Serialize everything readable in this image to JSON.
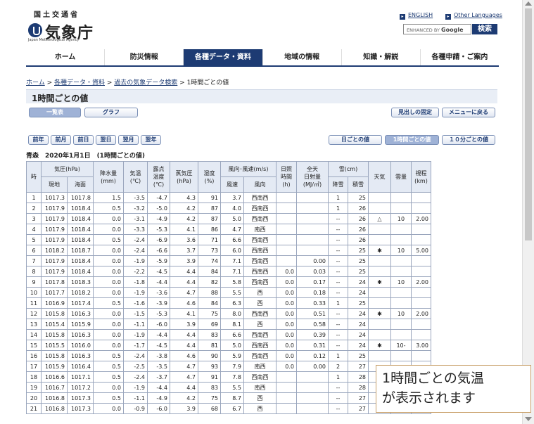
{
  "header": {
    "agency_jp_top": "国土交通省",
    "agency_name": "気象庁",
    "agency_en": "Japan Meteorological Agency",
    "english_link": "ENGLISH",
    "other_lang_link": "Other Languages",
    "search_placeholder": "ENHANCED BY",
    "search_brand": "Google",
    "search_button": "検索"
  },
  "nav": [
    "ホーム",
    "防災情報",
    "各種データ・資料",
    "地域の情報",
    "知識・解説",
    "各種申請・ご案内"
  ],
  "breadcrumb": {
    "home": "ホーム",
    "data": "各種データ・資料",
    "past": "過去の気象データ検索",
    "current": "1時間ごとの値",
    "sep": " > "
  },
  "page_title": "1時間ごとの値",
  "buttons": {
    "table": "一覧表",
    "graph": "グラフ",
    "fix_header": "見出しの固定",
    "back_menu": "メニューに戻る",
    "prev_year": "前年",
    "prev_month": "前月",
    "prev_day": "前日",
    "next_day": "翌日",
    "next_month": "翌月",
    "next_year": "翌年",
    "daily": "日ごとの値",
    "hourly": "1時間ごとの値",
    "ten_min": "１０分ごとの値"
  },
  "place_line": "青森　2020年1月1日　(1時間ごとの値)",
  "table": {
    "h_hour": "時",
    "h_pressure": "気圧(hPa)",
    "h_pres_local": "現地",
    "h_pres_sea": "海面",
    "h_precip": "降水量",
    "h_precip_unit": "(mm)",
    "h_temp": "気温",
    "h_temp_unit": "(℃)",
    "h_dew": "露点",
    "h_dew2": "温度",
    "h_dew_unit": "(℃)",
    "h_vapor": "蒸気圧",
    "h_vapor_unit": "(hPa)",
    "h_humid": "湿度",
    "h_humid_unit": "(%)",
    "h_wind": "風向･風速(m/s)",
    "h_wind_speed": "風速",
    "h_wind_dir": "風向",
    "h_sun": "日照",
    "h_sun2": "時間",
    "h_sun_unit": "(h)",
    "h_rad": "全天",
    "h_rad2": "日射量",
    "h_rad_unit": "(MJ/㎡)",
    "h_snow": "雪(cm)",
    "h_snowfall": "降雪",
    "h_snowdepth": "積雪",
    "h_weather": "天気",
    "h_cloud": "雲量",
    "h_vis": "視程",
    "h_vis_unit": "(km)",
    "rows": [
      [
        "1",
        "1017.3",
        "1017.8",
        "1.5",
        "-3.5",
        "-4.7",
        "4.3",
        "91",
        "3.7",
        "西南西",
        "",
        "",
        "1",
        "25",
        "",
        "",
        ""
      ],
      [
        "2",
        "1017.9",
        "1018.4",
        "0.5",
        "-3.2",
        "-5.0",
        "4.2",
        "87",
        "4.0",
        "西南西",
        "",
        "",
        "1",
        "26",
        "",
        "",
        ""
      ],
      [
        "3",
        "1017.9",
        "1018.4",
        "0.0",
        "-3.1",
        "-4.9",
        "4.2",
        "87",
        "5.0",
        "西南西",
        "",
        "",
        "--",
        "26",
        "△",
        "10",
        "2.00"
      ],
      [
        "4",
        "1017.9",
        "1018.4",
        "0.0",
        "-3.3",
        "-5.3",
        "4.1",
        "86",
        "4.7",
        "南西",
        "",
        "",
        "--",
        "26",
        "",
        "",
        ""
      ],
      [
        "5",
        "1017.9",
        "1018.4",
        "0.5",
        "-2.4",
        "-6.9",
        "3.6",
        "71",
        "6.6",
        "西南西",
        "",
        "",
        "--",
        "26",
        "",
        "",
        ""
      ],
      [
        "6",
        "1018.2",
        "1018.7",
        "0.0",
        "-2.4",
        "-6.6",
        "3.7",
        "73",
        "6.0",
        "西南西",
        "",
        "",
        "--",
        "25",
        "✱",
        "10",
        "5.00"
      ],
      [
        "7",
        "1017.9",
        "1018.4",
        "0.0",
        "-1.9",
        "-5.9",
        "3.9",
        "74",
        "7.1",
        "西南西",
        "",
        "0.00",
        "--",
        "25",
        "",
        "",
        ""
      ],
      [
        "8",
        "1017.9",
        "1018.4",
        "0.0",
        "-2.2",
        "-4.5",
        "4.4",
        "84",
        "7.1",
        "西南西",
        "0.0",
        "0.03",
        "--",
        "25",
        "",
        "",
        ""
      ],
      [
        "9",
        "1017.8",
        "1018.3",
        "0.0",
        "-1.8",
        "-4.4",
        "4.4",
        "82",
        "5.8",
        "西南西",
        "0.0",
        "0.17",
        "--",
        "24",
        "✱",
        "10",
        "2.00"
      ],
      [
        "10",
        "1017.7",
        "1018.2",
        "0.0",
        "-1.9",
        "-3.6",
        "4.7",
        "88",
        "5.5",
        "西",
        "0.0",
        "0.18",
        "--",
        "24",
        "",
        "",
        ""
      ],
      [
        "11",
        "1016.9",
        "1017.4",
        "0.5",
        "-1.6",
        "-3.9",
        "4.6",
        "84",
        "6.3",
        "西",
        "0.0",
        "0.33",
        "1",
        "25",
        "",
        "",
        ""
      ],
      [
        "12",
        "1015.8",
        "1016.3",
        "0.0",
        "-1.5",
        "-5.3",
        "4.1",
        "75",
        "8.0",
        "西南西",
        "0.0",
        "0.51",
        "--",
        "24",
        "✱",
        "10",
        "2.00"
      ],
      [
        "13",
        "1015.4",
        "1015.9",
        "0.0",
        "-1.1",
        "-6.0",
        "3.9",
        "69",
        "8.1",
        "西",
        "0.0",
        "0.58",
        "--",
        "24",
        "",
        "",
        ""
      ],
      [
        "14",
        "1015.8",
        "1016.3",
        "0.0",
        "-1.9",
        "-4.4",
        "4.4",
        "83",
        "6.6",
        "西南西",
        "0.0",
        "0.39",
        "--",
        "24",
        "",
        "",
        ""
      ],
      [
        "15",
        "1015.5",
        "1016.0",
        "0.0",
        "-1.7",
        "-4.5",
        "4.4",
        "81",
        "5.0",
        "西南西",
        "0.0",
        "0.31",
        "--",
        "24",
        "✱",
        "10-",
        "3.00"
      ],
      [
        "16",
        "1015.8",
        "1016.3",
        "0.5",
        "-2.4",
        "-3.8",
        "4.6",
        "90",
        "5.9",
        "西南西",
        "0.0",
        "0.12",
        "1",
        "25",
        "",
        "",
        ""
      ],
      [
        "17",
        "1015.9",
        "1016.4",
        "0.5",
        "-2.5",
        "-3.5",
        "4.7",
        "93",
        "7.9",
        "南西",
        "0.0",
        "0.00",
        "2",
        "27",
        "",
        "",
        ""
      ],
      [
        "18",
        "1016.6",
        "1017.1",
        "0.5",
        "-2.4",
        "-3.7",
        "4.7",
        "91",
        "7.8",
        "西南西",
        "",
        "",
        "1",
        "28",
        "",
        "",
        ""
      ],
      [
        "19",
        "1016.7",
        "1017.2",
        "0.0",
        "-1.9",
        "-4.4",
        "4.4",
        "83",
        "5.5",
        "南西",
        "",
        "",
        "--",
        "28",
        "",
        "",
        ""
      ],
      [
        "20",
        "1016.8",
        "1017.3",
        "0.5",
        "-1.1",
        "-4.9",
        "4.2",
        "75",
        "8.7",
        "西",
        "",
        "",
        "--",
        "27",
        "",
        "",
        ""
      ],
      [
        "21",
        "1016.8",
        "1017.3",
        "0.0",
        "-0.9",
        "-6.0",
        "3.9",
        "68",
        "6.7",
        "西",
        "",
        "",
        "--",
        "27",
        "",
        "",
        ""
      ]
    ]
  },
  "callout": {
    "line1": "1時間ごとの気温",
    "line2": "が表示されます"
  },
  "colors": {
    "brand": "#1d3b73",
    "header_cell": "#e4eaf4"
  }
}
